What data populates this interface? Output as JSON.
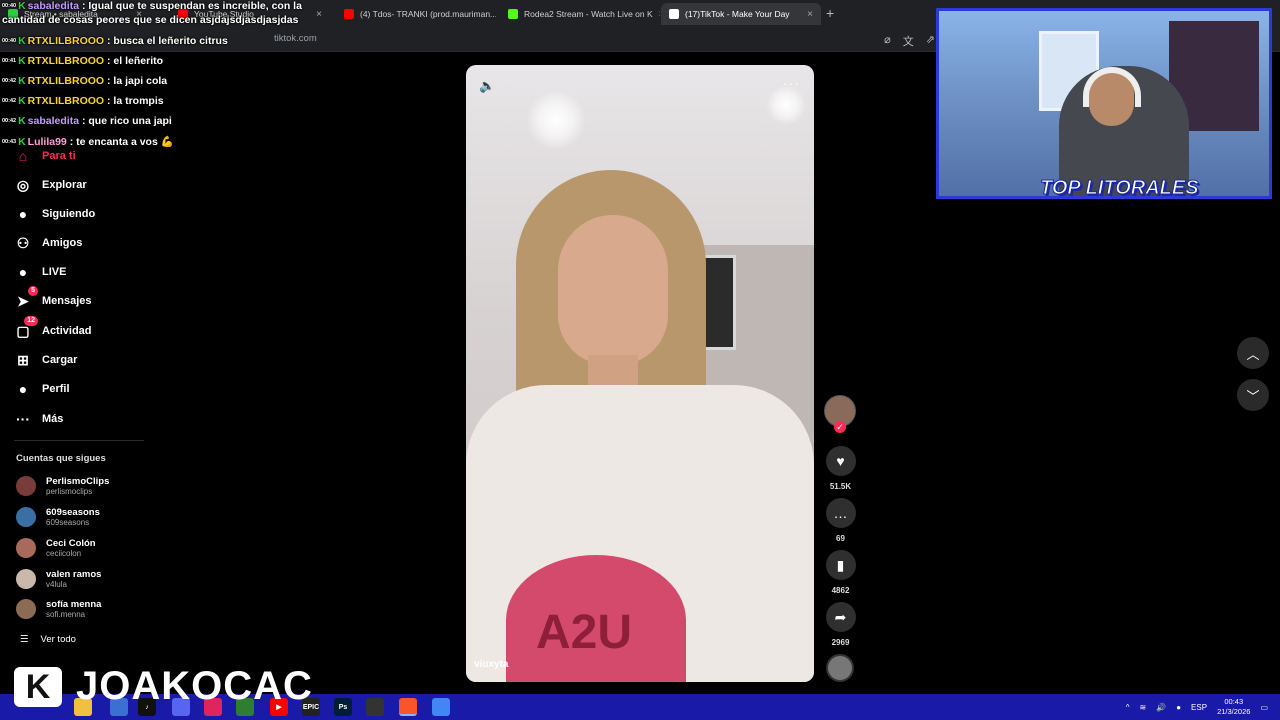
{
  "browser": {
    "tabs": [
      {
        "label": "Stream • sabaledita",
        "color": "#2ecc40",
        "active": false
      },
      {
        "label": "YouTube Studio",
        "color": "#ff0000",
        "active": false
      },
      {
        "label": "(4) Tdos- TRANKI (prod.mauriman...",
        "color": "#ff0000",
        "active": false
      },
      {
        "label": "Rodea2 Stream - Watch Live on K",
        "color": "#53fc18",
        "active": false
      },
      {
        "label": "(17)TikTok - Make Your Day",
        "color": "#ffffff",
        "active": true
      }
    ],
    "url": "tiktok.com"
  },
  "chat": [
    {
      "time": "00:40",
      "user": "sabaledita",
      "color": "purple",
      "text": ": Igual que te suspendan es increible, con la"
    },
    {
      "time": "",
      "user": "",
      "color": "purple",
      "text": "cantidad de cosas peores que se dicen asjdajsdjasdjasjdas"
    },
    {
      "time": "00:40",
      "user": "RTXLILBROOO",
      "color": "yellow",
      "text": ": busca el leñerito citrus"
    },
    {
      "time": "00:41",
      "user": "RTXLILBROOO",
      "color": "yellow",
      "text": ": el leñerito"
    },
    {
      "time": "00:42",
      "user": "RTXLILBROOO",
      "color": "yellow",
      "text": ": la japi cola"
    },
    {
      "time": "00:42",
      "user": "RTXLILBROOO",
      "color": "yellow",
      "text": ": la trompis"
    },
    {
      "time": "00:42",
      "user": "sabaledita",
      "color": "purple",
      "text": ": que rico una japi"
    },
    {
      "time": "00:43",
      "user": "Lulila99",
      "color": "pink",
      "text": ": te encanta a vos 💪"
    }
  ],
  "sidebar": {
    "nav": [
      {
        "label": "Para ti",
        "icon": "home-icon",
        "glyph": "⌂",
        "active": true
      },
      {
        "label": "Explorar",
        "icon": "compass-icon",
        "glyph": "◎"
      },
      {
        "label": "Siguiendo",
        "icon": "following-avatar-icon",
        "glyph": "●"
      },
      {
        "label": "Amigos",
        "icon": "friends-icon",
        "glyph": "⚇"
      },
      {
        "label": "LIVE",
        "icon": "live-avatar-icon",
        "glyph": "●"
      },
      {
        "label": "Mensajes",
        "icon": "messages-icon",
        "glyph": "➤",
        "badge": "5"
      },
      {
        "label": "Actividad",
        "icon": "activity-icon",
        "glyph": "▢",
        "badge": "12"
      },
      {
        "label": "Cargar",
        "icon": "upload-icon",
        "glyph": "⊞"
      },
      {
        "label": "Perfil",
        "icon": "profile-icon",
        "glyph": "●"
      },
      {
        "label": "Más",
        "icon": "more-icon",
        "glyph": "···"
      }
    ],
    "following_title": "Cuentas que sigues",
    "accounts": [
      {
        "name": "PerlismoClips",
        "handle": "perlismoclips",
        "color": "#7a3b3b"
      },
      {
        "name": "609seasons",
        "handle": "609seasons",
        "color": "#3a6fa3"
      },
      {
        "name": "Ceci Colón",
        "handle": "ceciicolon",
        "color": "#a86a5a"
      },
      {
        "name": "valen ramos",
        "handle": "v4lula",
        "color": "#c9b9aa"
      },
      {
        "name": "sofía menna",
        "handle": "sofi.menna",
        "color": "#8c6b55"
      }
    ],
    "see_all": "Ver todo"
  },
  "video": {
    "username": "viuxyta",
    "print_text": "A2U",
    "likes": "51.5K",
    "comments": "69",
    "saves": "4862",
    "shares": "2969"
  },
  "overlay": {
    "logo_letter": "K",
    "streamer_name": "JOAKOCAC",
    "cam_title": "TOP LITORALES"
  },
  "taskbar": {
    "apps": [
      {
        "label": "",
        "color": "#f0c040"
      },
      {
        "label": "",
        "color": "#3b6fd1"
      },
      {
        "label": "♪",
        "color": "#111111"
      },
      {
        "label": "",
        "color": "#5865f2"
      },
      {
        "label": "",
        "color": "#e0245e"
      },
      {
        "label": "",
        "color": "#2e7d32"
      },
      {
        "label": "▶",
        "color": "#ff0000"
      },
      {
        "label": "EPIC",
        "color": "#222222"
      },
      {
        "label": "Ps",
        "color": "#001e36"
      },
      {
        "label": "",
        "color": "#333333"
      },
      {
        "label": "",
        "color": "#fb542b"
      },
      {
        "label": "",
        "color": "#4285f4"
      }
    ],
    "lang": "ESP",
    "time": "00:43",
    "date": "21/3/2026"
  }
}
